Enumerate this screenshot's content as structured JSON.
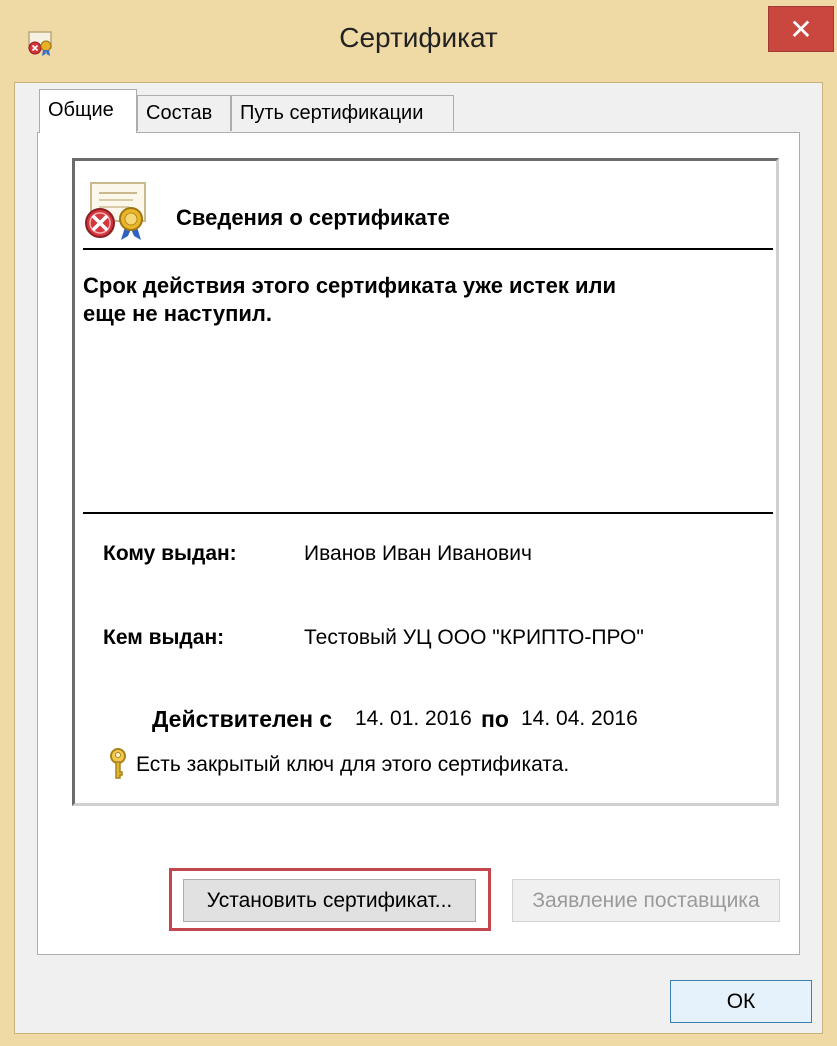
{
  "window": {
    "title": "Сертификат",
    "close_glyph": "✕"
  },
  "tabs": [
    {
      "label": "Общие",
      "active": true
    },
    {
      "label": "Состав",
      "active": false
    },
    {
      "label": "Путь сертификации",
      "active": false
    }
  ],
  "certificate": {
    "header": "Сведения о сертификате",
    "status_line1": "Срок действия этого сертификата уже истек или",
    "status_line2": "еще не наступил.",
    "issued_to_label": "Кому выдан:",
    "issued_to_value": "Иванов Иван Иванович",
    "issued_by_label": "Кем выдан:",
    "issued_by_value": "Тестовый УЦ ООО \"КРИПТО-ПРО\"",
    "valid_from_label": "Действителен с",
    "valid_from_value": "14. 01. 2016",
    "valid_to_label": "по",
    "valid_to_value": "14. 04. 2016",
    "private_key_note": "Есть закрытый ключ для этого сертификата."
  },
  "buttons": {
    "install": "Установить сертификат...",
    "issuer_statement": "Заявление поставщика",
    "ok": "ОК"
  },
  "icons": {
    "title": "certificate-error-icon",
    "cert": "certificate-error-icon",
    "key": "key-icon"
  },
  "colors": {
    "close_button": "#c9473f",
    "highlight_border": "#c1464e",
    "frame": "#efd9a4"
  }
}
